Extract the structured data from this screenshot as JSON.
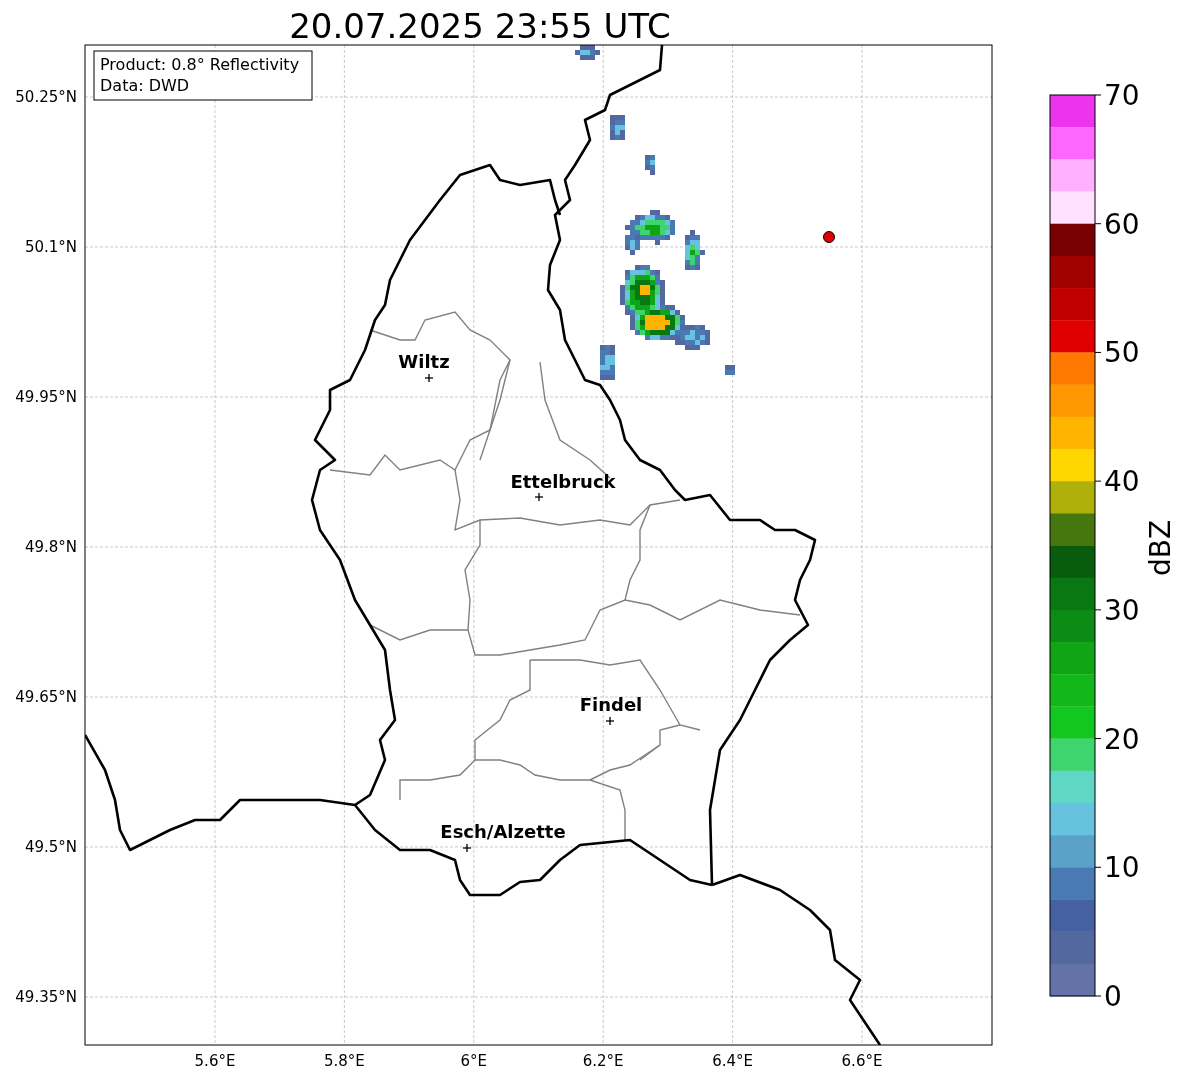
{
  "title": "20.07.2025 23:55 UTC",
  "info_box": [
    "Product: 0.8° Reflectivity",
    "Data: DWD"
  ],
  "map": {
    "lat_labels": [
      "50.25°N",
      "50.1°N",
      "49.95°N",
      "49.8°N",
      "49.65°N",
      "49.5°N",
      "49.35°N"
    ],
    "lon_labels": [
      "5.6°E",
      "5.8°E",
      "6°E",
      "6.2°E",
      "6.4°E",
      "6.6°E"
    ],
    "places": [
      {
        "name": "Wiltz"
      },
      {
        "name": "Ettelbruck"
      },
      {
        "name": "Findel"
      },
      {
        "name": "Esch/Alzette"
      }
    ]
  },
  "colorbar": {
    "label": "dBZ",
    "ticks": [
      "70",
      "60",
      "50",
      "40",
      "30",
      "20",
      "10",
      "0"
    ],
    "bins": [
      {
        "color": "#ee33ee"
      },
      {
        "color": "#ff66ff"
      },
      {
        "color": "#ffb0ff"
      },
      {
        "color": "#ffe0ff"
      },
      {
        "color": "#780000"
      },
      {
        "color": "#a00000"
      },
      {
        "color": "#c00000"
      },
      {
        "color": "#e00000"
      },
      {
        "color": "#ff7800"
      },
      {
        "color": "#ff9800"
      },
      {
        "color": "#ffb400"
      },
      {
        "color": "#ffd700"
      },
      {
        "color": "#b0b00a"
      },
      {
        "color": "#46760e"
      },
      {
        "color": "#085c0c"
      },
      {
        "color": "#0a7812"
      },
      {
        "color": "#0c8c14"
      },
      {
        "color": "#10a515"
      },
      {
        "color": "#12b81a"
      },
      {
        "color": "#12c81e"
      },
      {
        "color": "#3ed46e"
      },
      {
        "color": "#60d6c4"
      },
      {
        "color": "#66c2df"
      },
      {
        "color": "#5ba2c9"
      },
      {
        "color": "#4a7ab3"
      },
      {
        "color": "#4661a3"
      },
      {
        "color": "#5468a0"
      },
      {
        "color": "#6473a7"
      }
    ]
  }
}
